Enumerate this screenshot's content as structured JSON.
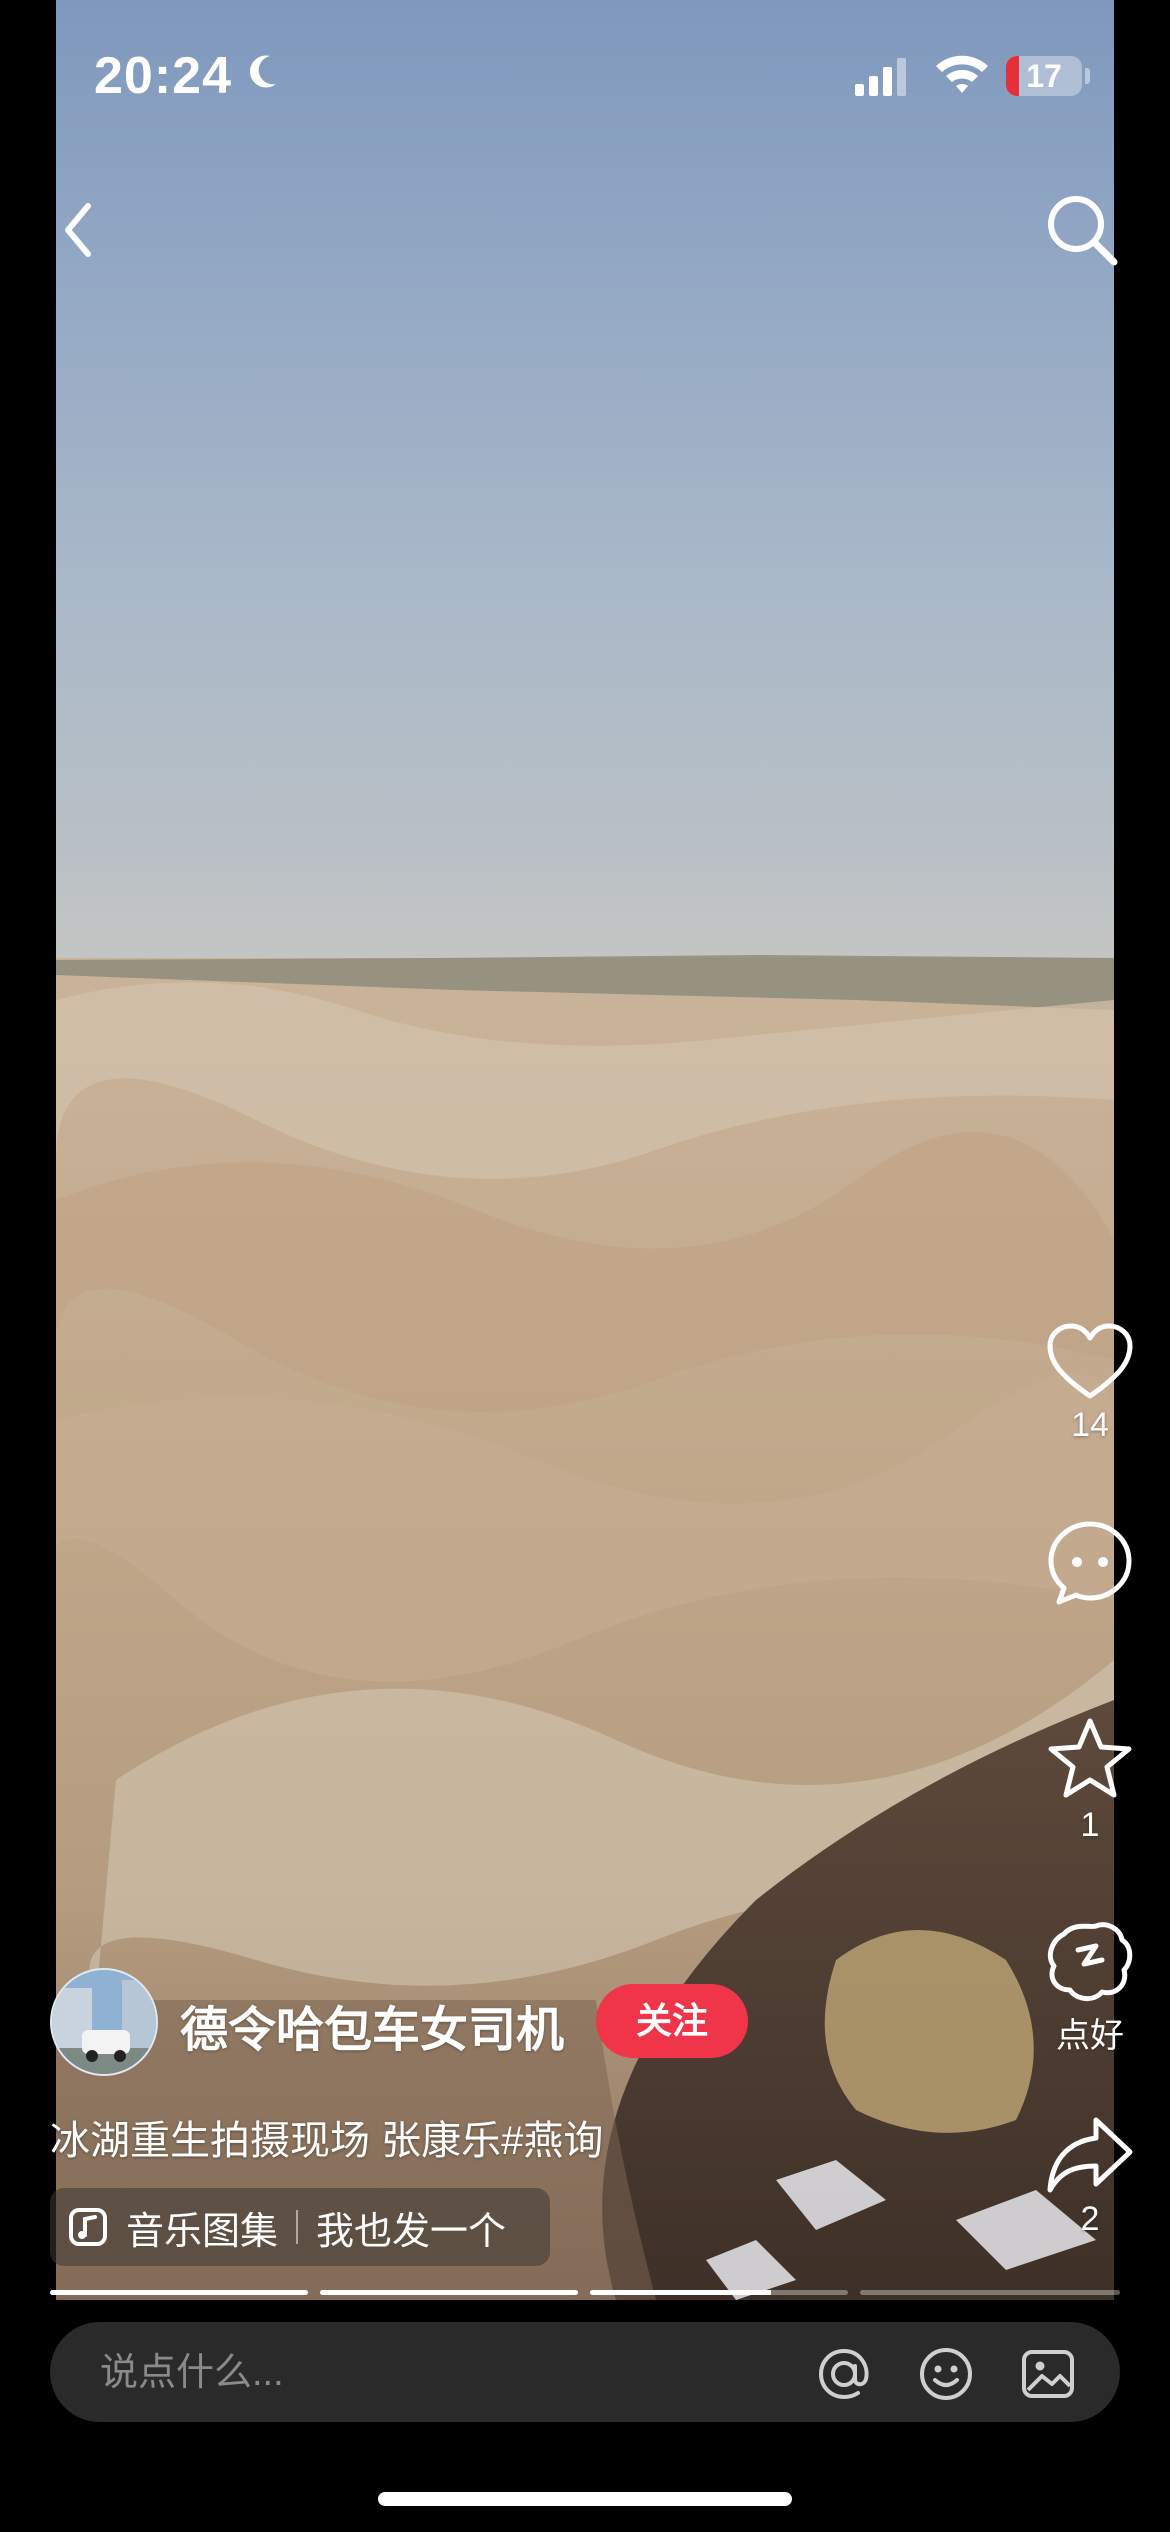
{
  "status_bar": {
    "time": "20:24",
    "battery_level": "17",
    "icons": [
      "moon-icon",
      "signal-icon",
      "wifi-icon",
      "battery-icon"
    ]
  },
  "nav": {
    "back_icon": "chevron-left-icon",
    "search_icon": "search-icon"
  },
  "actions": {
    "like_count": "14",
    "comment_icon": "comment-icon",
    "favorite_count": "1",
    "good_label": "点好",
    "share_count": "2"
  },
  "author": {
    "name": "德令哈包车女司机",
    "follow_label": "关注"
  },
  "caption": "冰湖重生拍摄现场 张康乐#燕询",
  "music": {
    "label": "音乐图集",
    "action_label": "我也发一个"
  },
  "progress": {
    "segments": 4,
    "current_segment": 3,
    "current_fraction": 0.7
  },
  "comment_bar": {
    "placeholder": "说点什么...",
    "icons": [
      "at-icon",
      "emoji-icon",
      "image-icon"
    ]
  },
  "colors": {
    "follow": "#f0344a",
    "battery_low": "#e5303a",
    "comment_bar_bg": "#2a2a2a"
  }
}
